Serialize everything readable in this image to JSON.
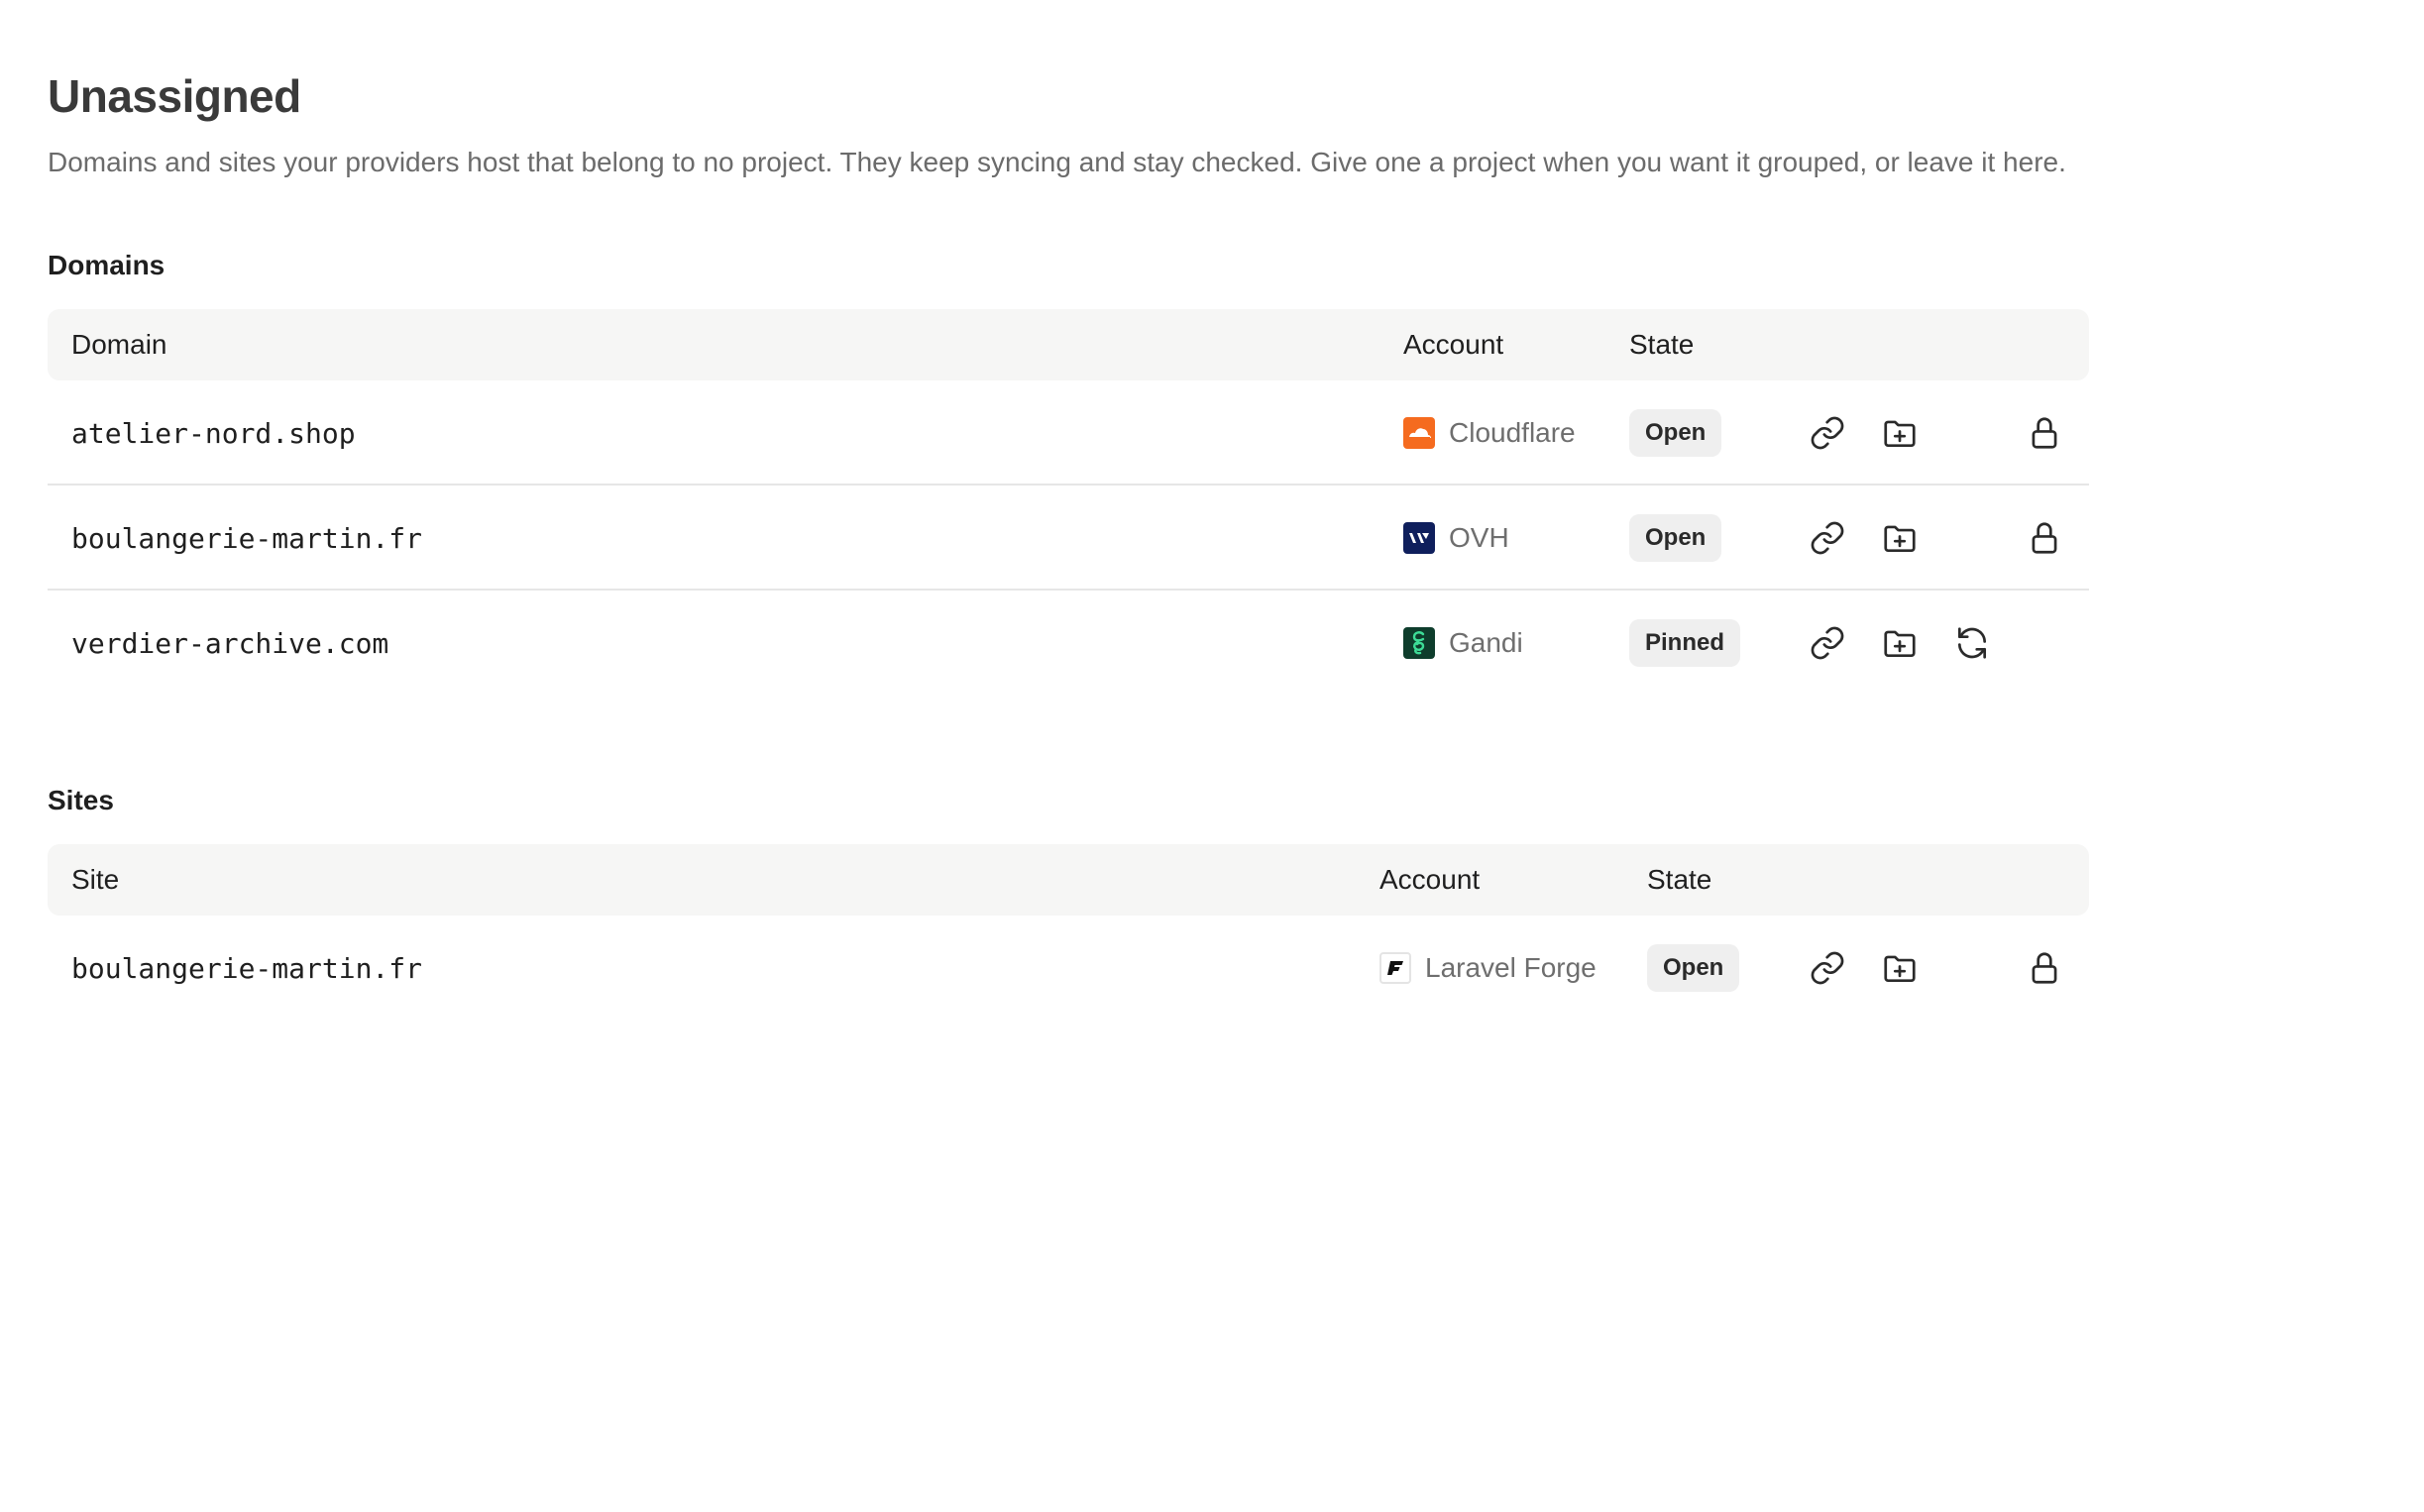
{
  "page": {
    "title": "Unassigned",
    "description": "Domains and sites your providers host that belong to no project. They keep syncing and stay checked. Give one a project when you want it grouped, or leave it here."
  },
  "domains": {
    "heading": "Domains",
    "columns": {
      "domain": "Domain",
      "account": "Account",
      "state": "State"
    },
    "rows": [
      {
        "name": "atelier-nord.shop",
        "account": "Cloudflare",
        "account_logo": "cloudflare-logo",
        "state": "Open",
        "actions": [
          "link-icon",
          "folder-plus-icon",
          "lock-icon"
        ]
      },
      {
        "name": "boulangerie-martin.fr",
        "account": "OVH",
        "account_logo": "ovh-logo",
        "state": "Open",
        "actions": [
          "link-icon",
          "folder-plus-icon",
          "lock-icon"
        ]
      },
      {
        "name": "verdier-archive.com",
        "account": "Gandi",
        "account_logo": "gandi-logo",
        "state": "Pinned",
        "actions": [
          "link-icon",
          "folder-plus-icon",
          "refresh-icon"
        ]
      }
    ]
  },
  "sites": {
    "heading": "Sites",
    "columns": {
      "site": "Site",
      "account": "Account",
      "state": "State"
    },
    "rows": [
      {
        "name": "boulangerie-martin.fr",
        "account": "Laravel Forge",
        "account_logo": "laravel-forge-logo",
        "state": "Open",
        "actions": [
          "link-icon",
          "folder-plus-icon",
          "lock-icon"
        ]
      }
    ]
  },
  "colors": {
    "cloudflare": "#f56b1f",
    "ovh": "#0f1f5c",
    "gandi": "#0e3d2c",
    "gandi_accent": "#3ddc97",
    "header_bg": "#f6f6f5",
    "badge_bg": "#efefef"
  }
}
